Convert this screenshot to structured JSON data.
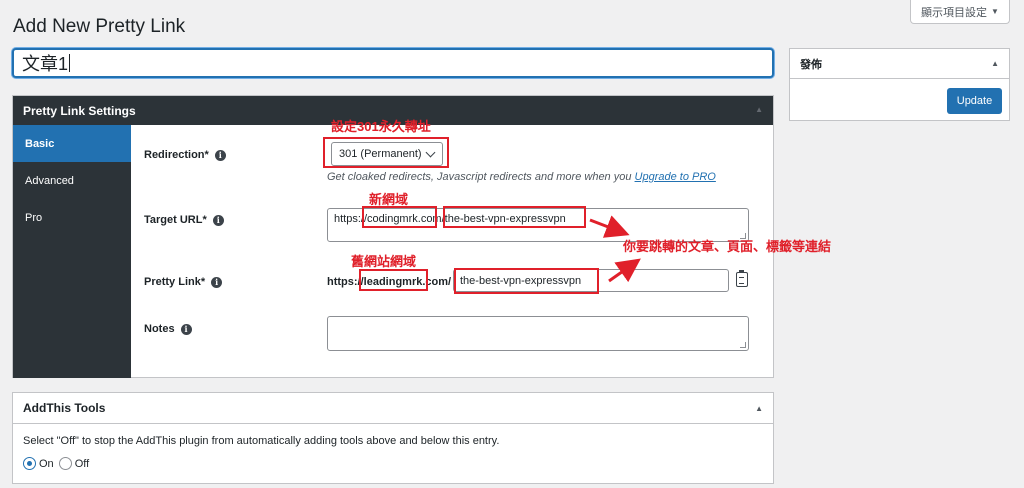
{
  "screen_options": {
    "label": "顯示項目設定",
    "caret": "▼"
  },
  "page": {
    "title": "Add New Pretty Link",
    "link_title_value": "文章1"
  },
  "settings": {
    "header": "Pretty Link Settings",
    "toggle": "▲",
    "nav": [
      {
        "label": "Basic",
        "active": true
      },
      {
        "label": "Advanced",
        "active": false
      },
      {
        "label": "Pro",
        "active": false
      }
    ],
    "info_glyph": "i",
    "redirection": {
      "label": "Redirection*",
      "value": "301 (Permanent)",
      "hint": "Get cloaked redirects, Javascript redirects and more when you",
      "hint_link": "Upgrade to PRO"
    },
    "target_url": {
      "label": "Target URL*",
      "value": "https://codingmrk.com/the-best-vpn-expressvpn"
    },
    "pretty_link": {
      "label": "Pretty Link*",
      "prefix": "https://leadingmrk.com/",
      "slug": "the-best-vpn-expressvpn"
    },
    "notes": {
      "label": "Notes",
      "value": ""
    }
  },
  "publish": {
    "header": "發佈",
    "toggle": "▲",
    "update_label": "Update"
  },
  "addthis": {
    "header": "AddThis Tools",
    "toggle": "▲",
    "description": "Select \"Off\" to stop the AddThis plugin from automatically adding tools above and below this entry.",
    "on_label": "On",
    "off_label": "Off",
    "selected": "On"
  },
  "annotations": {
    "redirect_note": "設定301永久轉址",
    "new_domain": "新網域",
    "old_domain": "舊網站網域",
    "target_note": "你要跳轉的文章、頁面、標籤等連結",
    "color": "#e0202a"
  }
}
